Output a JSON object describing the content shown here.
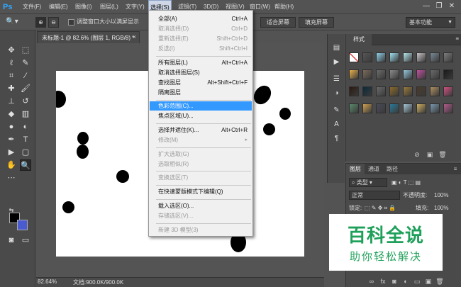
{
  "app": {
    "logo": "Ps"
  },
  "menubar": {
    "items": [
      "文件(F)",
      "编辑(E)",
      "图像(I)",
      "图层(L)",
      "文字(Y)",
      "选择(S)",
      "滤镜(T)",
      "3D(D)",
      "视图(V)",
      "窗口(W)",
      "帮助(H)"
    ],
    "active": "选择(S)"
  },
  "window_controls": {
    "minimize": "—",
    "restore": "❐",
    "close": "✕"
  },
  "options_bar": {
    "resize_checkbox_label": "调整窗口大小以满屏显示",
    "fit_screen_button": "适合屏幕",
    "fill_screen_button": "填充屏幕",
    "workspace_select": "基本功能"
  },
  "document": {
    "tab_label": "未标题-1 @ 82.6% (图层 1, RGB/8) *",
    "close": "×"
  },
  "statusbar": {
    "zoom": "82.64%",
    "doc_info": "文档:900.0K/900.0K"
  },
  "select_menu": {
    "items": [
      {
        "label": "全部(A)",
        "shortcut": "Ctrl+A",
        "disabled": false
      },
      {
        "label": "取消选择(D)",
        "shortcut": "Ctrl+D",
        "disabled": true
      },
      {
        "label": "重新选择(E)",
        "shortcut": "Shift+Ctrl+D",
        "disabled": true
      },
      {
        "label": "反选(I)",
        "shortcut": "Shift+Ctrl+I",
        "disabled": true
      },
      {
        "label": "所有图层(L)",
        "shortcut": "Alt+Ctrl+A",
        "disabled": false
      },
      {
        "label": "取消选择图层(S)",
        "shortcut": "",
        "disabled": false
      },
      {
        "label": "查找图层",
        "shortcut": "Alt+Shift+Ctrl+F",
        "disabled": false
      },
      {
        "label": "隔离图层",
        "shortcut": "",
        "disabled": false
      },
      {
        "label": "色彩范围(C)...",
        "shortcut": "",
        "disabled": false,
        "highlighted": true
      },
      {
        "label": "焦点区域(U)...",
        "shortcut": "",
        "disabled": false
      },
      {
        "label": "选择并遮住(K)...",
        "shortcut": "Alt+Ctrl+R",
        "disabled": false
      },
      {
        "label": "修改(M)",
        "shortcut": "",
        "disabled": true,
        "submenu": true
      },
      {
        "label": "扩大选取(G)",
        "shortcut": "",
        "disabled": true
      },
      {
        "label": "选取相似(R)",
        "shortcut": "",
        "disabled": true
      },
      {
        "label": "变换选区(T)",
        "shortcut": "",
        "disabled": true
      },
      {
        "label": "在快速蒙版模式下编辑(Q)",
        "shortcut": "",
        "disabled": false
      },
      {
        "label": "载入选区(O)...",
        "shortcut": "",
        "disabled": false
      },
      {
        "label": "存储选区(V)...",
        "shortcut": "",
        "disabled": true
      },
      {
        "label": "新建 3D 模型(3)",
        "shortcut": "",
        "disabled": true
      }
    ]
  },
  "styles_panel": {
    "tab": "样式",
    "menu_icon": "≡"
  },
  "layers_panel": {
    "tabs": [
      "图层",
      "通道",
      "路径"
    ],
    "filter_kind": "类型",
    "blend_mode": "正常",
    "opacity_label": "不透明度:",
    "opacity_value": "100%",
    "lock_label": "锁定:",
    "fill_label": "填充:",
    "fill_value": "100%"
  },
  "watermark": {
    "title": "百科全说",
    "subtitle": "助你轻松解决"
  },
  "colors": {
    "foreground": "#000000",
    "background": "#4a5ad0",
    "highlight": "#3399ff",
    "watermark": "#1fa05a"
  }
}
